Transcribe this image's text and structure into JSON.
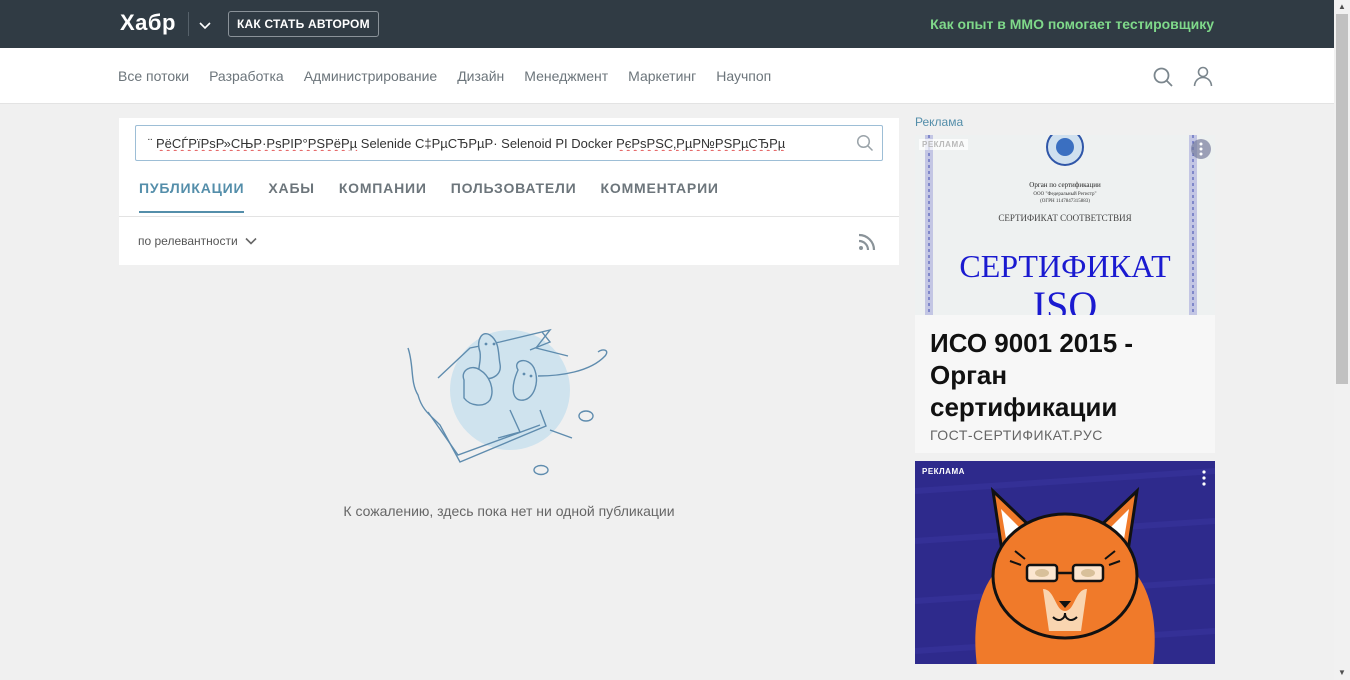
{
  "header": {
    "logo": "Хабр",
    "author_button": "КАК СТАТЬ АВТОРОМ",
    "promo_link": "Как опыт в ММО помогает тестировщику"
  },
  "nav": {
    "items": [
      "Все потоки",
      "Разработка",
      "Администрирование",
      "Дизайн",
      "Менеджмент",
      "Маркетинг",
      "Научпоп"
    ]
  },
  "search": {
    "value_prefix": "¨ ",
    "value_junk1": "РёСЃРїРѕР»СЊР·РѕРІР°РЅРёРµ",
    "value_mid": " Selenide С‡РµСЂРµР· Selenoid РІ Docker ",
    "value_junk2": "РєРѕРЅС‚РµР№РЅРµСЂРµ"
  },
  "tabs": [
    "ПУБЛИКАЦИИ",
    "ХАБЫ",
    "КОМПАНИИ",
    "ПОЛЬЗОВАТЕЛИ",
    "КОММЕНТАРИИ"
  ],
  "sort": {
    "label": "по релевантности"
  },
  "empty": {
    "message": "К сожалению, здесь пока нет ни одной публикации"
  },
  "ads": {
    "section_label": "Реклама",
    "ad1": {
      "badge": "РЕКЛАМА",
      "cert_org": "Орган по сертификации",
      "cert_org2": "ООО \"Федеральный Регистр\"",
      "cert_org3": "(ОГРН 1147847315883)",
      "cert_title": "СЕРТИФИКАТ СООТВЕТСТВИЯ",
      "cert_big": "СЕРТИФИКАТ",
      "cert_iso": "ISO",
      "title": "ИСО 9001 2015 - Орган сертификации",
      "domain": "ГОСТ-СЕРТИФИКАТ.РУС"
    },
    "ad2": {
      "badge": "РЕКЛАМА"
    }
  },
  "colors": {
    "topbar": "#303b44",
    "accent": "#548eaa",
    "promo": "#7fd98a",
    "ad2_bg": "#2e2a8c"
  }
}
